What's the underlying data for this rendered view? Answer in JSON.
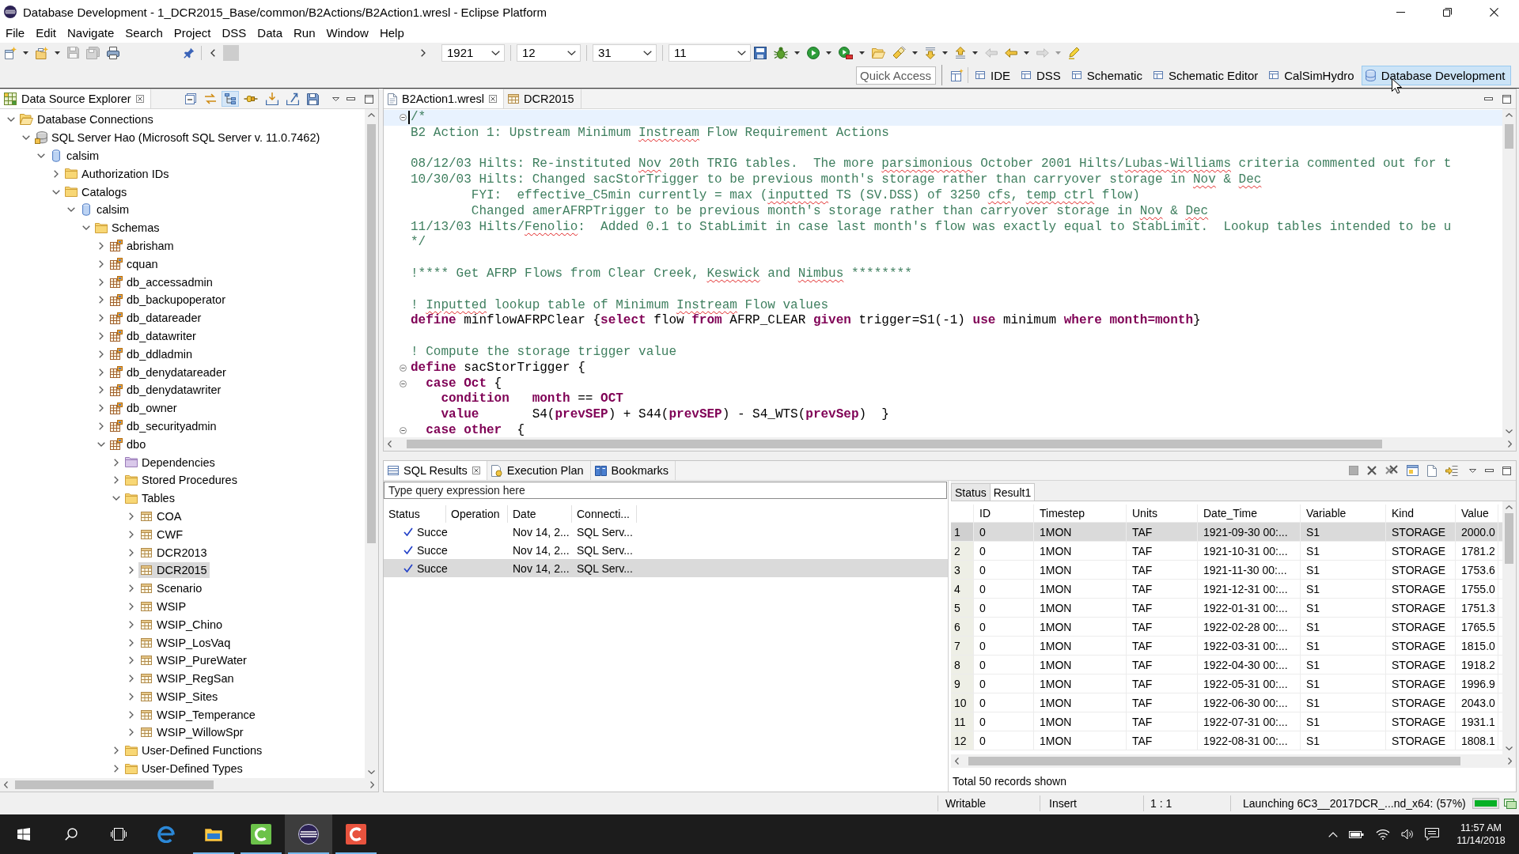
{
  "window": {
    "title": "Database Development - 1_DCR2015_Base/common/B2Actions/B2Action1.wresl - Eclipse Platform"
  },
  "menu_bar": [
    "File",
    "Edit",
    "Navigate",
    "Search",
    "Project",
    "DSS",
    "Data",
    "Run",
    "Window",
    "Help"
  ],
  "toolbar": {
    "file_buttons": [
      {
        "disabled": false,
        "has_menu": true
      },
      {
        "disabled": false,
        "has_menu": true
      },
      {
        "disabled": true,
        "has_menu": false
      },
      {
        "disabled": true,
        "has_menu": false
      },
      {
        "disabled": false,
        "has_menu": false
      }
    ],
    "date_combos": [
      {
        "value": "1921"
      },
      {
        "value": "12"
      },
      {
        "value": "31"
      },
      {
        "value": "11"
      }
    ],
    "run_buttons": [
      {
        "disabled": false,
        "has_menu": false
      },
      {
        "disabled": false,
        "has_menu": true
      },
      {
        "disabled": false,
        "has_menu": true
      },
      {
        "disabled": false,
        "has_menu": true
      },
      {
        "disabled": false,
        "has_menu": false
      },
      {
        "disabled": false,
        "has_menu": true
      },
      {
        "disabled": false,
        "has_menu": true
      },
      {
        "disabled": false,
        "has_menu": true
      },
      {
        "disabled": true,
        "has_menu": false
      },
      {
        "disabled": false,
        "has_menu": true
      },
      {
        "disabled": true,
        "has_menu": true
      },
      {
        "disabled": false,
        "has_menu": false
      }
    ],
    "quick_access": {
      "placeholder": "Quick Access"
    },
    "perspectives": [
      {
        "label": "IDE",
        "kind": "layout",
        "selected": false
      },
      {
        "label": "DSS",
        "kind": "layout",
        "selected": false
      },
      {
        "label": "Schematic",
        "kind": "layout",
        "selected": false
      },
      {
        "label": "Schematic Editor",
        "kind": "layout",
        "selected": false
      },
      {
        "label": "CalSimHydro",
        "kind": "layout",
        "selected": false
      },
      {
        "label": "Database Development",
        "kind": "database",
        "selected": true
      }
    ]
  },
  "data_source_explorer": {
    "tab": {
      "label": "Data Source Explorer",
      "selected": true
    },
    "tools": [
      {
        "pressed": false
      },
      {
        "pressed": false
      },
      {
        "pressed": true
      },
      {
        "pressed": false
      },
      {
        "pressed": false
      },
      {
        "pressed": false
      },
      {
        "pressed": false
      }
    ],
    "tree": [
      {
        "label": "Database Connections",
        "kind": "connections",
        "expanded": true,
        "selected": false,
        "children": [
          {
            "label": "SQL Server Hao (Microsoft SQL Server v. 11.0.7462)",
            "kind": "server",
            "expanded": true,
            "selected": false,
            "children": [
              {
                "label": "calsim",
                "kind": "database",
                "expanded": true,
                "selected": false,
                "children": [
                  {
                    "label": "Authorization IDs",
                    "kind": "folder",
                    "expanded": false,
                    "selected": false
                  },
                  {
                    "label": "Catalogs",
                    "kind": "folder",
                    "expanded": true,
                    "selected": false,
                    "children": [
                      {
                        "label": "calsim",
                        "kind": "database",
                        "expanded": true,
                        "selected": false,
                        "children": [
                          {
                            "label": "Schemas",
                            "kind": "folder",
                            "expanded": true,
                            "selected": false,
                            "children": [
                              {
                                "label": "abrisham",
                                "kind": "schema",
                                "expanded": false,
                                "selected": false
                              },
                              {
                                "label": "cquan",
                                "kind": "schema",
                                "expanded": false,
                                "selected": false
                              },
                              {
                                "label": "db_accessadmin",
                                "kind": "schema",
                                "expanded": false,
                                "selected": false
                              },
                              {
                                "label": "db_backupoperator",
                                "kind": "schema",
                                "expanded": false,
                                "selected": false
                              },
                              {
                                "label": "db_datareader",
                                "kind": "schema",
                                "expanded": false,
                                "selected": false
                              },
                              {
                                "label": "db_datawriter",
                                "kind": "schema",
                                "expanded": false,
                                "selected": false
                              },
                              {
                                "label": "db_ddladmin",
                                "kind": "schema",
                                "expanded": false,
                                "selected": false
                              },
                              {
                                "label": "db_denydatareader",
                                "kind": "schema",
                                "expanded": false,
                                "selected": false
                              },
                              {
                                "label": "db_denydatawriter",
                                "kind": "schema",
                                "expanded": false,
                                "selected": false
                              },
                              {
                                "label": "db_owner",
                                "kind": "schema",
                                "expanded": false,
                                "selected": false
                              },
                              {
                                "label": "db_securityadmin",
                                "kind": "schema",
                                "expanded": false,
                                "selected": false
                              },
                              {
                                "label": "dbo",
                                "kind": "schema",
                                "expanded": true,
                                "selected": false,
                                "children": [
                                  {
                                    "label": "Dependencies",
                                    "kind": "dependencies",
                                    "expanded": false,
                                    "selected": false
                                  },
                                  {
                                    "label": "Stored Procedures",
                                    "kind": "folder",
                                    "expanded": false,
                                    "selected": false
                                  },
                                  {
                                    "label": "Tables",
                                    "kind": "folder",
                                    "expanded": true,
                                    "selected": false,
                                    "children": [
                                      {
                                        "label": "COA",
                                        "kind": "table",
                                        "expanded": false,
                                        "selected": false
                                      },
                                      {
                                        "label": "CWF",
                                        "kind": "table",
                                        "expanded": false,
                                        "selected": false
                                      },
                                      {
                                        "label": "DCR2013",
                                        "kind": "table",
                                        "expanded": false,
                                        "selected": false
                                      },
                                      {
                                        "label": "DCR2015",
                                        "kind": "table",
                                        "expanded": false,
                                        "selected": true
                                      },
                                      {
                                        "label": "Scenario",
                                        "kind": "table",
                                        "expanded": false,
                                        "selected": false
                                      },
                                      {
                                        "label": "WSIP",
                                        "kind": "table",
                                        "expanded": false,
                                        "selected": false
                                      },
                                      {
                                        "label": "WSIP_Chino",
                                        "kind": "table",
                                        "expanded": false,
                                        "selected": false
                                      },
                                      {
                                        "label": "WSIP_LosVaq",
                                        "kind": "table",
                                        "expanded": false,
                                        "selected": false
                                      },
                                      {
                                        "label": "WSIP_PureWater",
                                        "kind": "table",
                                        "expanded": false,
                                        "selected": false
                                      },
                                      {
                                        "label": "WSIP_RegSan",
                                        "kind": "table",
                                        "expanded": false,
                                        "selected": false
                                      },
                                      {
                                        "label": "WSIP_Sites",
                                        "kind": "table",
                                        "expanded": false,
                                        "selected": false
                                      },
                                      {
                                        "label": "WSIP_Temperance",
                                        "kind": "table",
                                        "expanded": false,
                                        "selected": false
                                      },
                                      {
                                        "label": "WSIP_WillowSpr",
                                        "kind": "table",
                                        "expanded": false,
                                        "selected": false
                                      }
                                    ]
                                  },
                                  {
                                    "label": "User-Defined Functions",
                                    "kind": "folder",
                                    "expanded": false,
                                    "selected": false
                                  },
                                  {
                                    "label": "User-Defined Types",
                                    "kind": "folder",
                                    "expanded": false,
                                    "selected": false
                                  }
                                ]
                              }
                            ]
                          }
                        ]
                      }
                    ]
                  }
                ]
              }
            ]
          }
        ]
      }
    ]
  },
  "editor": {
    "tabs": [
      {
        "label": "B2Action1.wresl",
        "kind": "file",
        "selected": true
      },
      {
        "label": "DCR2015",
        "kind": "table",
        "selected": false
      }
    ],
    "lines": [
      {
        "kind": "text",
        "fold": true,
        "current": true,
        "segments": [
          {
            "kind": "comment",
            "text": "/*"
          }
        ]
      },
      {
        "kind": "text",
        "fold": false,
        "current": false,
        "segments": [
          {
            "kind": "comment",
            "text": "B2 Action 1: Upstream Minimum "
          },
          {
            "kind": "comment_flagged",
            "text": "Instream"
          },
          {
            "kind": "comment",
            "text": " Flow Requirement Actions"
          }
        ]
      },
      {
        "kind": "blank",
        "fold": false,
        "current": false
      },
      {
        "kind": "text",
        "fold": false,
        "current": false,
        "segments": [
          {
            "kind": "comment",
            "text": "08/12/03 Hilts: Re-instituted "
          },
          {
            "kind": "comment_flagged",
            "text": "Nov"
          },
          {
            "kind": "comment",
            "text": " 20th TRIG tables.  The more "
          },
          {
            "kind": "comment_flagged",
            "text": "parsimonious"
          },
          {
            "kind": "comment",
            "text": " October 2001 Hilts/"
          },
          {
            "kind": "comment_flagged",
            "text": "Lubas-Williams"
          },
          {
            "kind": "comment",
            "text": " criteria commented out for t"
          }
        ]
      },
      {
        "kind": "text",
        "fold": false,
        "current": false,
        "segments": [
          {
            "kind": "comment",
            "text": "10/30/03 Hilts: Changed sacStorTrigger to be previous month's storage rather than carryover storage in "
          },
          {
            "kind": "comment_flagged",
            "text": "Nov"
          },
          {
            "kind": "comment",
            "text": " & "
          },
          {
            "kind": "comment_flagged",
            "text": "Dec"
          }
        ]
      },
      {
        "kind": "text",
        "fold": false,
        "current": false,
        "segments": [
          {
            "kind": "comment",
            "text": "        FYI:  effective_C5min currently = max ("
          },
          {
            "kind": "comment_flagged",
            "text": "inputted"
          },
          {
            "kind": "comment",
            "text": " TS (SV.DSS) of 3250 "
          },
          {
            "kind": "comment_flagged",
            "text": "cfs"
          },
          {
            "kind": "comment",
            "text": ", "
          },
          {
            "kind": "comment_flagged",
            "text": "temp ctrl"
          },
          {
            "kind": "comment",
            "text": " flow)"
          }
        ]
      },
      {
        "kind": "text",
        "fold": false,
        "current": false,
        "segments": [
          {
            "kind": "comment",
            "text": "        Changed amerAFRPTrigger to be previous month's storage rather than carryover storage in "
          },
          {
            "kind": "comment_flagged",
            "text": "Nov"
          },
          {
            "kind": "comment",
            "text": " & "
          },
          {
            "kind": "comment_flagged",
            "text": "Dec"
          }
        ]
      },
      {
        "kind": "text",
        "fold": false,
        "current": false,
        "segments": [
          {
            "kind": "comment",
            "text": "11/13/03 Hilts/"
          },
          {
            "kind": "comment_flagged",
            "text": "Fenolio"
          },
          {
            "kind": "comment",
            "text": ":  Added 0.1 to StabLimit in case last month's flow was exactly equal to StabLimit.  Lookup tables intended to be u"
          }
        ]
      },
      {
        "kind": "text",
        "fold": false,
        "current": false,
        "segments": [
          {
            "kind": "comment",
            "text": "*/"
          }
        ]
      },
      {
        "kind": "blank",
        "fold": false,
        "current": false
      },
      {
        "kind": "text",
        "fold": false,
        "current": false,
        "segments": [
          {
            "kind": "comment",
            "text": "!**** Get AFRP Flows from Clear Creek, "
          },
          {
            "kind": "comment_flagged",
            "text": "Keswick"
          },
          {
            "kind": "comment",
            "text": " and "
          },
          {
            "kind": "comment_flagged",
            "text": "Nimbus"
          },
          {
            "kind": "comment",
            "text": " ********"
          }
        ]
      },
      {
        "kind": "blank",
        "fold": false,
        "current": false
      },
      {
        "kind": "text",
        "fold": false,
        "current": false,
        "segments": [
          {
            "kind": "comment",
            "text": "! "
          },
          {
            "kind": "comment_flagged",
            "text": "Inputted"
          },
          {
            "kind": "comment",
            "text": " lookup table of Minimum "
          },
          {
            "kind": "comment_flagged",
            "text": "Instream"
          },
          {
            "kind": "comment",
            "text": " Flow values"
          }
        ]
      },
      {
        "kind": "text",
        "fold": false,
        "current": false,
        "segments": [
          {
            "kind": "keyword",
            "text": "define"
          },
          {
            "kind": "code",
            "text": " minflowAFRPClear {"
          },
          {
            "kind": "keyword",
            "text": "select"
          },
          {
            "kind": "code",
            "text": " flow "
          },
          {
            "kind": "keyword",
            "text": "from"
          },
          {
            "kind": "code",
            "text": " AFRP_CLEAR "
          },
          {
            "kind": "keyword",
            "text": "given"
          },
          {
            "kind": "code",
            "text": " trigger=S1(-1) "
          },
          {
            "kind": "keyword",
            "text": "use"
          },
          {
            "kind": "code",
            "text": " minimum "
          },
          {
            "kind": "keyword",
            "text": "where month=month"
          },
          {
            "kind": "code",
            "text": "}"
          }
        ]
      },
      {
        "kind": "blank",
        "fold": false,
        "current": false
      },
      {
        "kind": "text",
        "fold": false,
        "current": false,
        "segments": [
          {
            "kind": "comment",
            "text": "! Compute the storage trigger value"
          }
        ]
      },
      {
        "kind": "text",
        "fold": true,
        "current": false,
        "segments": [
          {
            "kind": "keyword",
            "text": "define"
          },
          {
            "kind": "code",
            "text": " sacStorTrigger {"
          }
        ]
      },
      {
        "kind": "text",
        "fold": true,
        "current": false,
        "segments": [
          {
            "kind": "keyword",
            "text": "  case Oct"
          },
          {
            "kind": "code",
            "text": " {"
          }
        ]
      },
      {
        "kind": "text",
        "fold": false,
        "current": false,
        "segments": [
          {
            "kind": "keyword",
            "text": "    condition   month"
          },
          {
            "kind": "code",
            "text": " == "
          },
          {
            "kind": "keyword",
            "text": "OCT"
          }
        ]
      },
      {
        "kind": "text",
        "fold": false,
        "current": false,
        "segments": [
          {
            "kind": "keyword",
            "text": "    value"
          },
          {
            "kind": "code",
            "text": "       S4("
          },
          {
            "kind": "keyword",
            "text": "prevSEP"
          },
          {
            "kind": "code",
            "text": ") + S44("
          },
          {
            "kind": "keyword",
            "text": "prevSEP"
          },
          {
            "kind": "code",
            "text": ") - S4_WTS("
          },
          {
            "kind": "keyword",
            "text": "prevSep"
          },
          {
            "kind": "code",
            "text": ")  }"
          }
        ]
      },
      {
        "kind": "text",
        "fold": true,
        "current": false,
        "segments": [
          {
            "kind": "keyword",
            "text": "  case other"
          },
          {
            "kind": "code",
            "text": "  {"
          }
        ]
      }
    ]
  },
  "results_panel": {
    "tabs": [
      {
        "label": "SQL Results",
        "kind": "results",
        "selected": true
      },
      {
        "label": "Execution Plan",
        "kind": "plan",
        "selected": false
      },
      {
        "label": "Bookmarks",
        "kind": "bookmarks",
        "selected": false
      }
    ],
    "tools": [
      {
        "disabled": true
      },
      {
        "disabled": false
      },
      {
        "disabled": false
      },
      {
        "disabled": false
      },
      {
        "disabled": false
      },
      {
        "disabled": false
      }
    ],
    "filter": {
      "placeholder": "Type query expression here"
    },
    "history": {
      "columns": [
        "Status",
        "Operation",
        "Date",
        "Connecti..."
      ],
      "rows": [
        {
          "succeeded": true,
          "status": "Succe",
          "date": "Nov 14, 2...",
          "connection": "SQL Serv...",
          "selected": false
        },
        {
          "succeeded": true,
          "status": "Succe",
          "date": "Nov 14, 2...",
          "connection": "SQL Serv...",
          "selected": false
        },
        {
          "succeeded": true,
          "status": "Succe",
          "date": "Nov 14, 2...",
          "connection": "SQL Serv...",
          "selected": true
        }
      ]
    },
    "result_tabs": [
      {
        "label": "Status",
        "selected": false
      },
      {
        "label": "Result1",
        "selected": true
      }
    ],
    "result_table": {
      "columns": [
        "ID",
        "Timestep",
        "Units",
        "Date_Time",
        "Variable",
        "Kind",
        "Value"
      ],
      "rows": [
        {
          "number": "1",
          "cells": [
            "0",
            "1MON",
            "TAF",
            "1921-09-30 00:...",
            "S1",
            "STORAGE",
            "2000.0"
          ],
          "selected": true
        },
        {
          "number": "2",
          "cells": [
            "0",
            "1MON",
            "TAF",
            "1921-10-31 00:...",
            "S1",
            "STORAGE",
            "1781.2"
          ],
          "selected": false
        },
        {
          "number": "3",
          "cells": [
            "0",
            "1MON",
            "TAF",
            "1921-11-30 00:...",
            "S1",
            "STORAGE",
            "1753.6"
          ],
          "selected": false
        },
        {
          "number": "4",
          "cells": [
            "0",
            "1MON",
            "TAF",
            "1921-12-31 00:...",
            "S1",
            "STORAGE",
            "1755.0"
          ],
          "selected": false
        },
        {
          "number": "5",
          "cells": [
            "0",
            "1MON",
            "TAF",
            "1922-01-31 00:...",
            "S1",
            "STORAGE",
            "1751.3"
          ],
          "selected": false
        },
        {
          "number": "6",
          "cells": [
            "0",
            "1MON",
            "TAF",
            "1922-02-28 00:...",
            "S1",
            "STORAGE",
            "1765.5"
          ],
          "selected": false
        },
        {
          "number": "7",
          "cells": [
            "0",
            "1MON",
            "TAF",
            "1922-03-31 00:...",
            "S1",
            "STORAGE",
            "1815.0"
          ],
          "selected": false
        },
        {
          "number": "8",
          "cells": [
            "0",
            "1MON",
            "TAF",
            "1922-04-30 00:...",
            "S1",
            "STORAGE",
            "1918.2"
          ],
          "selected": false
        },
        {
          "number": "9",
          "cells": [
            "0",
            "1MON",
            "TAF",
            "1922-05-31 00:...",
            "S1",
            "STORAGE",
            "1996.9"
          ],
          "selected": false
        },
        {
          "number": "10",
          "cells": [
            "0",
            "1MON",
            "TAF",
            "1922-06-30 00:...",
            "S1",
            "STORAGE",
            "2043.0"
          ],
          "selected": false
        },
        {
          "number": "11",
          "cells": [
            "0",
            "1MON",
            "TAF",
            "1922-07-31 00:...",
            "S1",
            "STORAGE",
            "1931.1"
          ],
          "selected": false
        },
        {
          "number": "12",
          "cells": [
            "0",
            "1MON",
            "TAF",
            "1922-08-31 00:...",
            "S1",
            "STORAGE",
            "1808.1"
          ],
          "selected": false
        }
      ]
    },
    "summary": "Total 50 records shown"
  },
  "status_bar": {
    "fields": [
      "Writable",
      "Insert",
      "1 : 1"
    ],
    "progress": {
      "label": "Launching 6C3__2017DCR_...nd_x64: (57%)",
      "level": 1
    }
  },
  "taskbar": {
    "apps": [
      {
        "running": false,
        "active": false
      },
      {
        "running": true,
        "active": false
      },
      {
        "running": true,
        "active": false
      },
      {
        "running": true,
        "active": true
      },
      {
        "running": true,
        "active": false
      }
    ],
    "clock": {
      "time": "11:57 AM",
      "date": "11/14/2018"
    }
  }
}
